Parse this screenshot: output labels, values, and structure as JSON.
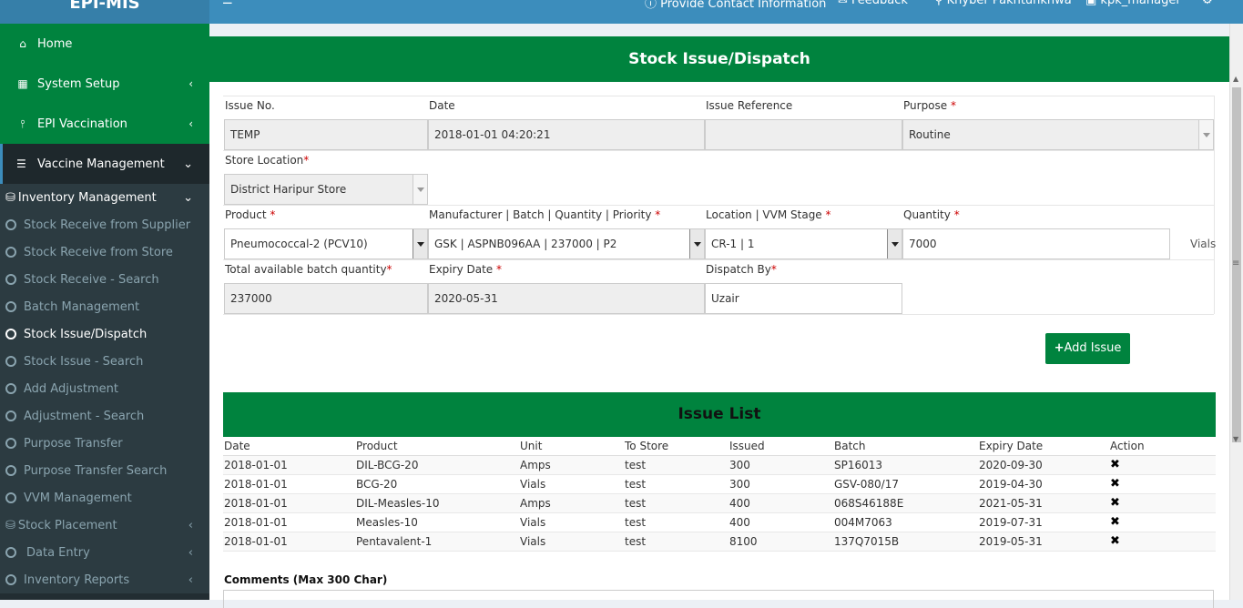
{
  "app": {
    "logo": "EPI-MIS"
  },
  "topbar": {
    "menu_icon": "bars-icon",
    "contact": "Provide Contact Information",
    "feedback": "Feedback",
    "province": "Khyber Pakhtunkhwa",
    "user": "kpk_manager"
  },
  "sidebar": {
    "home": "Home",
    "system_setup": "System Setup",
    "epi_vaccination": "EPI Vaccination",
    "vaccine_management": "Vaccine Management",
    "inventory_management": "Inventory Management",
    "sub_items": [
      "Stock Receive from Supplier",
      "Stock Receive from Store",
      "Stock Receive - Search",
      "Batch Management",
      "Stock Issue/Dispatch",
      "Stock Issue - Search",
      "Add Adjustment",
      "Adjustment - Search",
      "Purpose Transfer",
      "Purpose Transfer Search",
      "VVM Management"
    ],
    "stock_placement": "Stock Placement",
    "data_entry": "Data Entry",
    "inventory_reports": "Inventory Reports"
  },
  "page": {
    "title": "Stock Issue/Dispatch"
  },
  "form": {
    "issue_no_label": "Issue No.",
    "issue_no": "TEMP",
    "date_label": "Date",
    "date": "2018-01-01 04:20:21",
    "issue_ref_label": "Issue Reference",
    "issue_ref": "",
    "purpose_label": "Purpose",
    "purpose": "Routine",
    "store_location_label": "Store Location",
    "store_location": "District Haripur Store",
    "product_label": "Product",
    "product": "Pneumococcal-2 (PCV10)",
    "mbqp_label": "Manufacturer | Batch | Quantity | Priority",
    "mbqp": "GSK | ASPNB096AA | 237000 | P2",
    "location_label": "Location | VVM Stage",
    "location": "CR-1 | 1",
    "quantity_label": "Quantity",
    "quantity": "7000",
    "quantity_unit": "Vials",
    "total_label": "Total available batch quantity",
    "total": "237000",
    "expiry_label": "Expiry Date",
    "expiry": "2020-05-31",
    "dispatch_label": "Dispatch By",
    "dispatch": "Uzair",
    "required_mark": "*",
    "add_issue": "Add Issue",
    "add_icon": "plus-icon"
  },
  "issue_list": {
    "title": "Issue List",
    "columns": [
      "Date",
      "Product",
      "Unit",
      "To Store",
      "Issued",
      "Batch",
      "Expiry Date",
      "Action"
    ],
    "rows": [
      [
        "2018-01-01",
        "DIL-BCG-20",
        "Amps",
        "test",
        "300",
        "SP16013",
        "2020-09-30"
      ],
      [
        "2018-01-01",
        "BCG-20",
        "Vials",
        "test",
        "300",
        "GSV-080/17",
        "2019-04-30"
      ],
      [
        "2018-01-01",
        "DIL-Measles-10",
        "Amps",
        "test",
        "400",
        "068S46188E",
        "2021-05-31"
      ],
      [
        "2018-01-01",
        "Measles-10",
        "Vials",
        "test",
        "400",
        "004M7063",
        "2019-07-31"
      ],
      [
        "2018-01-01",
        "Pentavalent-1",
        "Vials",
        "test",
        "8100",
        "137Q7015B",
        "2019-05-31"
      ]
    ],
    "delete_icon": "close-icon"
  },
  "comments": {
    "label": "Comments (Max 300 Char)"
  }
}
